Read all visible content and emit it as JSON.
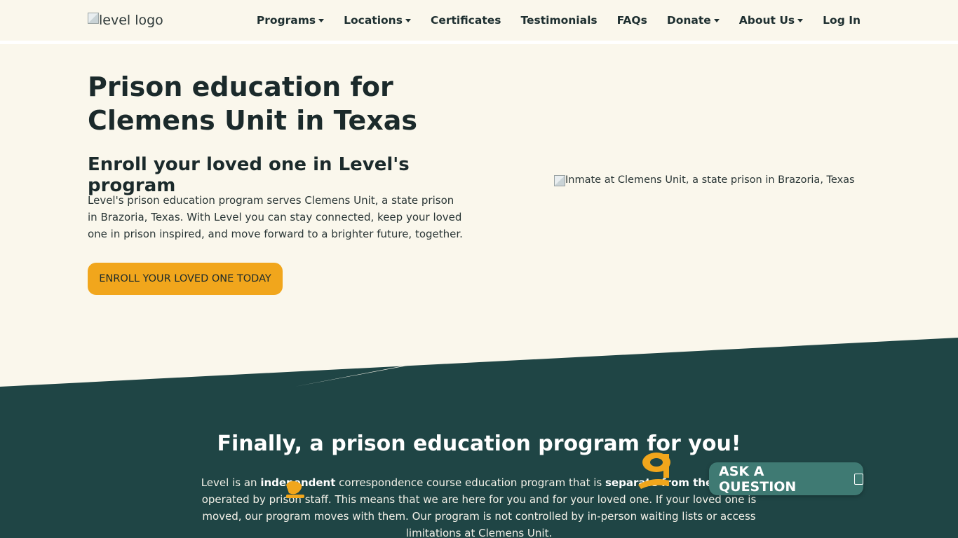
{
  "header": {
    "logo_alt": "level logo",
    "nav": [
      {
        "label": "Programs",
        "dropdown": true
      },
      {
        "label": "Locations",
        "dropdown": true
      },
      {
        "label": "Certificates",
        "dropdown": false
      },
      {
        "label": "Testimonials",
        "dropdown": false
      },
      {
        "label": "FAQs",
        "dropdown": false
      },
      {
        "label": "Donate",
        "dropdown": true
      },
      {
        "label": "About Us",
        "dropdown": true
      },
      {
        "label": "Log In",
        "dropdown": false
      }
    ]
  },
  "hero": {
    "title": "Prison education for Clemens Unit in Texas",
    "subtitle": "Enroll your loved one in Level's program",
    "description": "Level's prison education program serves Clemens Unit, a state prison in Brazoria, Texas. With Level you can stay connected, keep your loved one in prison inspired, and move forward to a brighter future, together.",
    "cta_label": "ENROLL YOUR LOVED ONE TODAY",
    "image_alt": "Inmate at Clemens Unit, a state prison in Brazoria, Texas"
  },
  "section": {
    "title": "Finally, a prison education program for you!",
    "text_parts": [
      "Level is an ",
      "independent",
      " correspondence course education program that is ",
      "separate from the facility",
      " operated by prison staff. This means that we are here for you and for your loved one. If your loved one is moved, our program moves with them. Our program is not controlled by in-person waiting lists or access limitations at Clemens Unit."
    ]
  },
  "ask_button": {
    "label": "ASK A QUESTION"
  },
  "colors": {
    "cream": "#faf7ec",
    "dark_teal": "#1f4545",
    "gold": "#f1a61c",
    "ask_teal": "#3f7a73"
  }
}
